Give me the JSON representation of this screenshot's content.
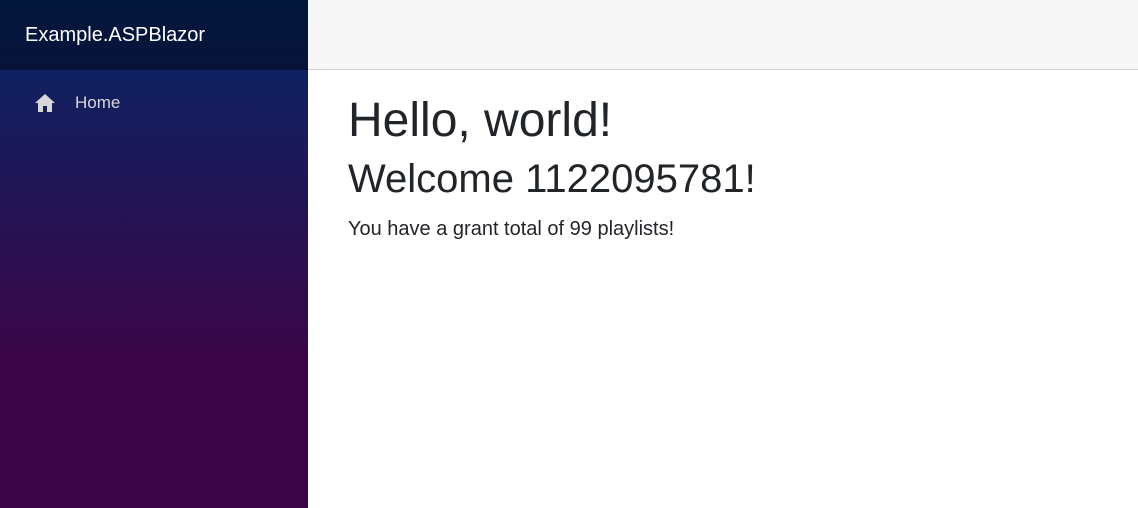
{
  "sidebar": {
    "brand": "Example.ASPBlazor",
    "items": [
      {
        "label": "Home",
        "icon": "home-icon"
      }
    ]
  },
  "main": {
    "heading": "Hello, world!",
    "welcome": "Welcome 1122095781!",
    "summary": "You have a grant total of 99 playlists!"
  },
  "colors": {
    "sidebar_top": "#052767",
    "sidebar_bottom": "#3a0647",
    "topbar_bg": "#f7f7f7",
    "text": "#212529"
  }
}
